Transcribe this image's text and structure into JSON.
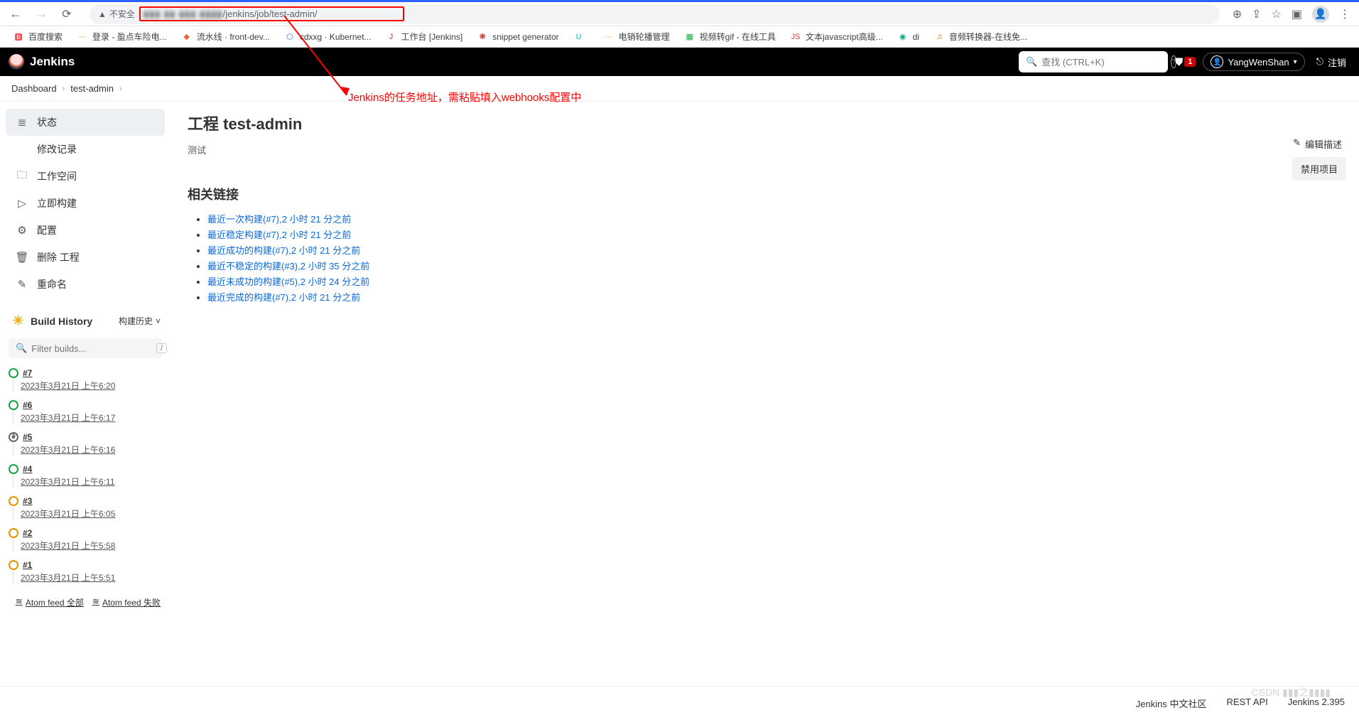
{
  "browser": {
    "insecure_label": "不安全",
    "url_hidden": "▮▮▮ ▮▮ ▮▮▮ ▮▮▮▮",
    "url_visible": "/jenkins/job/test-admin/",
    "bookmarks": [
      {
        "label": "百度搜索",
        "icon": "🅱",
        "color": "#ff4d4d"
      },
      {
        "label": "登录 - 盈点车险电...",
        "icon": "···",
        "color": "#ff8800"
      },
      {
        "label": "流水线 · front-dev...",
        "icon": "◆",
        "color": "#e8682b"
      },
      {
        "label": "cdxxg · Kubernet...",
        "icon": "⬡",
        "color": "#326ce5"
      },
      {
        "label": "工作台 [Jenkins]",
        "icon": "J",
        "color": "#d33833"
      },
      {
        "label": "snippet generator",
        "icon": "❋",
        "color": "#cc0003"
      },
      {
        "label": "",
        "icon": "U",
        "color": "#00bcd4"
      },
      {
        "label": "电销轮播管理",
        "icon": "···",
        "color": "#ff8800"
      },
      {
        "label": "视频转gif - 在线工具",
        "icon": "▦",
        "color": "#1aab40"
      },
      {
        "label": "文本javascript高级...",
        "icon": "JS",
        "color": "#d44"
      },
      {
        "label": "di",
        "icon": "◉",
        "color": "#0ea882"
      },
      {
        "label": "音频转换器-在线免...",
        "icon": "♫",
        "color": "#ff6a00"
      }
    ]
  },
  "header": {
    "brand": "Jenkins",
    "search_placeholder": "查找 (CTRL+K)",
    "alert_count": "1",
    "username": "YangWenShan",
    "logout": "注销"
  },
  "breadcrumbs": [
    {
      "label": "Dashboard"
    },
    {
      "label": "test-admin"
    }
  ],
  "annotation": {
    "text": "Jenkins的任务地址，需粘贴填入webhooks配置中"
  },
  "sidebar": {
    "items": [
      {
        "icon": "≣",
        "label": "状态",
        "active": true
      },
      {
        "icon": "</>",
        "label": "修改记录"
      },
      {
        "icon": "🗀",
        "label": "工作空间"
      },
      {
        "icon": "▷",
        "label": "立即构建"
      },
      {
        "icon": "⚙",
        "label": "配置"
      },
      {
        "icon": "🗑",
        "label": "删除 工程"
      },
      {
        "icon": "✎",
        "label": "重命名"
      }
    ],
    "build_history_title": "Build History",
    "build_history_dropdown": "构建历史",
    "filter_placeholder": "Filter builds...",
    "builds": [
      {
        "num": "#7",
        "status": "success",
        "date": "2023年3月21日 上午6:20"
      },
      {
        "num": "#6",
        "status": "success",
        "date": "2023年3月21日 上午6:17"
      },
      {
        "num": "#5",
        "status": "fail",
        "date": "2023年3月21日 上午6:16"
      },
      {
        "num": "#4",
        "status": "success",
        "date": "2023年3月21日 上午6:11"
      },
      {
        "num": "#3",
        "status": "warn",
        "date": "2023年3月21日 上午6:05"
      },
      {
        "num": "#2",
        "status": "warn",
        "date": "2023年3月21日 上午5:58"
      },
      {
        "num": "#1",
        "status": "warn",
        "date": "2023年3月21日 上午5:51"
      }
    ],
    "atom_all": "Atom feed 全部",
    "atom_fail": "Atom feed 失败"
  },
  "content": {
    "title": "工程 test-admin",
    "description": "测试",
    "edit_desc": "编辑描述",
    "disable_btn": "禁用项目",
    "related_heading": "相关链接",
    "related_links": [
      "最近一次构建(#7),2 小时 21 分之前",
      "最近稳定构建(#7),2 小时 21 分之前",
      "最近成功的构建(#7),2 小时 21 分之前",
      "最近不稳定的构建(#3),2 小时 35 分之前",
      "最近未成功的构建(#5),2 小时 24 分之前",
      "最近完成的构建(#7),2 小时 21 分之前"
    ]
  },
  "footer": {
    "community": "Jenkins 中文社区",
    "rest_api": "REST API",
    "version": "Jenkins 2.395"
  },
  "watermark": "CSDN ▮▮▮之▮▮▮▮"
}
